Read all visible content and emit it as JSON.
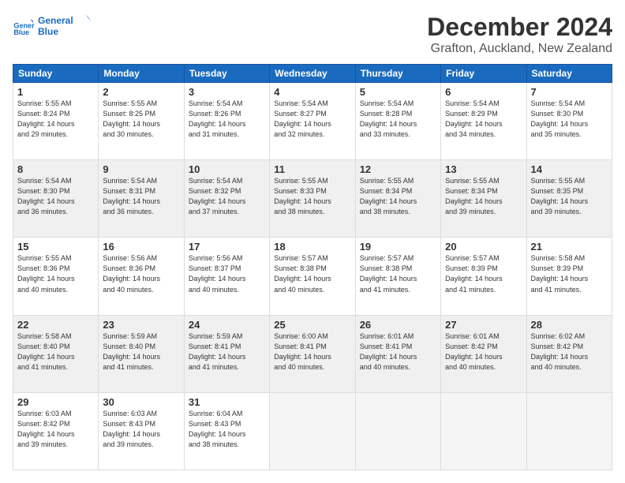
{
  "logo": {
    "line1": "General",
    "line2": "Blue"
  },
  "title": "December 2024",
  "subtitle": "Grafton, Auckland, New Zealand",
  "days_of_week": [
    "Sunday",
    "Monday",
    "Tuesday",
    "Wednesday",
    "Thursday",
    "Friday",
    "Saturday"
  ],
  "weeks": [
    [
      {
        "day": "1",
        "info": "Sunrise: 5:55 AM\nSunset: 8:24 PM\nDaylight: 14 hours\nand 29 minutes."
      },
      {
        "day": "2",
        "info": "Sunrise: 5:55 AM\nSunset: 8:25 PM\nDaylight: 14 hours\nand 30 minutes."
      },
      {
        "day": "3",
        "info": "Sunrise: 5:54 AM\nSunset: 8:26 PM\nDaylight: 14 hours\nand 31 minutes."
      },
      {
        "day": "4",
        "info": "Sunrise: 5:54 AM\nSunset: 8:27 PM\nDaylight: 14 hours\nand 32 minutes."
      },
      {
        "day": "5",
        "info": "Sunrise: 5:54 AM\nSunset: 8:28 PM\nDaylight: 14 hours\nand 33 minutes."
      },
      {
        "day": "6",
        "info": "Sunrise: 5:54 AM\nSunset: 8:29 PM\nDaylight: 14 hours\nand 34 minutes."
      },
      {
        "day": "7",
        "info": "Sunrise: 5:54 AM\nSunset: 8:30 PM\nDaylight: 14 hours\nand 35 minutes."
      }
    ],
    [
      {
        "day": "8",
        "info": "Sunrise: 5:54 AM\nSunset: 8:30 PM\nDaylight: 14 hours\nand 36 minutes."
      },
      {
        "day": "9",
        "info": "Sunrise: 5:54 AM\nSunset: 8:31 PM\nDaylight: 14 hours\nand 36 minutes."
      },
      {
        "day": "10",
        "info": "Sunrise: 5:54 AM\nSunset: 8:32 PM\nDaylight: 14 hours\nand 37 minutes."
      },
      {
        "day": "11",
        "info": "Sunrise: 5:55 AM\nSunset: 8:33 PM\nDaylight: 14 hours\nand 38 minutes."
      },
      {
        "day": "12",
        "info": "Sunrise: 5:55 AM\nSunset: 8:34 PM\nDaylight: 14 hours\nand 38 minutes."
      },
      {
        "day": "13",
        "info": "Sunrise: 5:55 AM\nSunset: 8:34 PM\nDaylight: 14 hours\nand 39 minutes."
      },
      {
        "day": "14",
        "info": "Sunrise: 5:55 AM\nSunset: 8:35 PM\nDaylight: 14 hours\nand 39 minutes."
      }
    ],
    [
      {
        "day": "15",
        "info": "Sunrise: 5:55 AM\nSunset: 8:36 PM\nDaylight: 14 hours\nand 40 minutes."
      },
      {
        "day": "16",
        "info": "Sunrise: 5:56 AM\nSunset: 8:36 PM\nDaylight: 14 hours\nand 40 minutes."
      },
      {
        "day": "17",
        "info": "Sunrise: 5:56 AM\nSunset: 8:37 PM\nDaylight: 14 hours\nand 40 minutes."
      },
      {
        "day": "18",
        "info": "Sunrise: 5:57 AM\nSunset: 8:38 PM\nDaylight: 14 hours\nand 40 minutes."
      },
      {
        "day": "19",
        "info": "Sunrise: 5:57 AM\nSunset: 8:38 PM\nDaylight: 14 hours\nand 41 minutes."
      },
      {
        "day": "20",
        "info": "Sunrise: 5:57 AM\nSunset: 8:39 PM\nDaylight: 14 hours\nand 41 minutes."
      },
      {
        "day": "21",
        "info": "Sunrise: 5:58 AM\nSunset: 8:39 PM\nDaylight: 14 hours\nand 41 minutes."
      }
    ],
    [
      {
        "day": "22",
        "info": "Sunrise: 5:58 AM\nSunset: 8:40 PM\nDaylight: 14 hours\nand 41 minutes."
      },
      {
        "day": "23",
        "info": "Sunrise: 5:59 AM\nSunset: 8:40 PM\nDaylight: 14 hours\nand 41 minutes."
      },
      {
        "day": "24",
        "info": "Sunrise: 5:59 AM\nSunset: 8:41 PM\nDaylight: 14 hours\nand 41 minutes."
      },
      {
        "day": "25",
        "info": "Sunrise: 6:00 AM\nSunset: 8:41 PM\nDaylight: 14 hours\nand 40 minutes."
      },
      {
        "day": "26",
        "info": "Sunrise: 6:01 AM\nSunset: 8:41 PM\nDaylight: 14 hours\nand 40 minutes."
      },
      {
        "day": "27",
        "info": "Sunrise: 6:01 AM\nSunset: 8:42 PM\nDaylight: 14 hours\nand 40 minutes."
      },
      {
        "day": "28",
        "info": "Sunrise: 6:02 AM\nSunset: 8:42 PM\nDaylight: 14 hours\nand 40 minutes."
      }
    ],
    [
      {
        "day": "29",
        "info": "Sunrise: 6:03 AM\nSunset: 8:42 PM\nDaylight: 14 hours\nand 39 minutes."
      },
      {
        "day": "30",
        "info": "Sunrise: 6:03 AM\nSunset: 8:43 PM\nDaylight: 14 hours\nand 39 minutes."
      },
      {
        "day": "31",
        "info": "Sunrise: 6:04 AM\nSunset: 8:43 PM\nDaylight: 14 hours\nand 38 minutes."
      },
      {
        "day": "",
        "info": ""
      },
      {
        "day": "",
        "info": ""
      },
      {
        "day": "",
        "info": ""
      },
      {
        "day": "",
        "info": ""
      }
    ]
  ]
}
